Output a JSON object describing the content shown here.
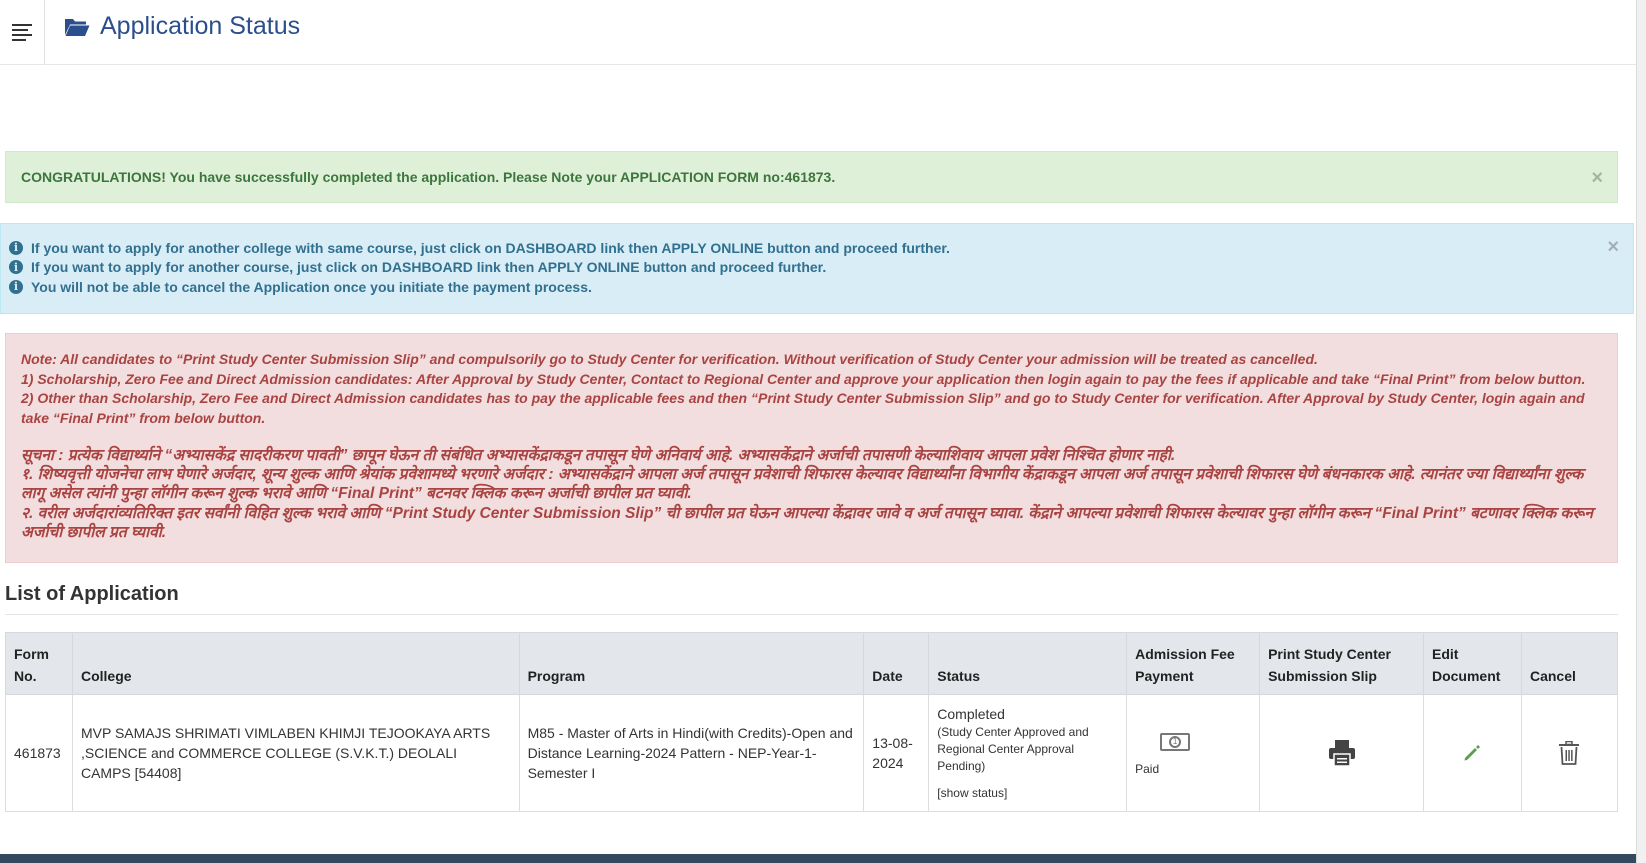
{
  "header": {
    "title": "Application Status",
    "menu_icon": "hamburger-icon",
    "title_icon": "folder-open-icon"
  },
  "alerts": {
    "success": {
      "text": "CONGRATULATIONS! You have successfully completed the application. Please Note your APPLICATION FORM no:461873.",
      "close": "×"
    },
    "info": {
      "lines": [
        "If you want to apply for another college with same course, just click on DASHBOARD link then APPLY ONLINE button and proceed further.",
        "If you want to apply for another course, just click on DASHBOARD link then APPLY ONLINE button and proceed further.",
        "You will not be able to cancel the Application once you initiate the payment process."
      ],
      "close": "×"
    },
    "danger": {
      "english": [
        "Note: All candidates to “Print Study Center Submission Slip” and compulsorily go to Study Center for verification. Without verification of Study Center your admission will be treated as cancelled.",
        "1) Scholarship, Zero Fee and Direct Admission candidates: After Approval by Study Center, Contact to Regional Center and approve your application then login again to pay the fees if applicable and take “Final Print” from below button.",
        "2) Other than Scholarship, Zero Fee and Direct Admission candidates has to pay the applicable fees and then “Print Study Center Submission Slip” and go to Study Center for verification. After Approval by Study Center, login again and take “Final Print” from below button."
      ],
      "marathi": [
        "सूचना : प्रत्येक विद्यार्थ्याने “अभ्यासकेंद्र सादरीकरण पावती” छापून घेऊन ती संबंधित अभ्यासकेंद्राकडून तपासून घेणे अनिवार्य आहे. अभ्यासकेंद्राने अर्जाची तपासणी केल्याशिवाय आपला प्रवेश निश्चित होणार नाही.",
        "१. शिष्यवृत्ती योजनेचा लाभ घेणारे अर्जदार, शून्य शुल्क आणि श्रेयांक प्रवेशामध्ये भरणारे अर्जदार : अभ्यासकेंद्राने आपला अर्ज तपासून प्रवेशाची शिफारस केल्यावर विद्यार्थ्यांना विभागीय केंद्राकडून आपला अर्ज तपासून प्रवेशाची शिफारस घेणे बंधनकारक आहे. त्यानंतर ज्या विद्यार्थ्यांना शुल्क लागू असेल त्यांनी पुन्हा लॉगीन करून शुल्क भरावे आणि “Final Print” बटनवर क्लिक करून अर्जाची छापील प्रत घ्यावी.",
        "२. वरील अर्जदारांव्यतिरिक्त इतर सर्वांनी विहित शुल्क भरावे आणि “Print Study Center Submission Slip” ची छापील प्रत घेऊन आपल्या केंद्रावर जावे व अर्ज तपासून घ्यावा. केंद्राने आपल्या प्रवेशाची शिफारस केल्यावर पुन्हा लॉगीन करून “Final Print” बटणावर क्लिक करून अर्जाची छापील प्रत घ्यावी."
      ]
    }
  },
  "list": {
    "heading": "List of Application",
    "columns": [
      "Form No.",
      "College",
      "Program",
      "Date",
      "Status",
      "Admission Fee Payment",
      "Print Study Center Submission Slip",
      "Edit Document",
      "Cancel"
    ],
    "rows": [
      {
        "form_no": "461873",
        "college": "MVP SAMAJS SHRIMATI VIMLABEN KHIMJI TEJOOKAYA ARTS ,SCIENCE and COMMERCE COLLEGE (S.V.K.T.) DEOLALI CAMPS [54408]",
        "program": "M85 - Master of Arts in Hindi(with Credits)-Open and Distance Learning-2024 Pattern - NEP-Year-1-Semester I",
        "date": "13-08-2024",
        "status": "Completed",
        "status_detail": "(Study Center Approved and Regional Center Approval Pending)",
        "show_status": "[show status]",
        "payment": "Paid",
        "payment_icon": "money-bill-icon",
        "print_icon": "printer-icon",
        "edit_icon": "pencil-icon",
        "cancel_icon": "trash-icon"
      }
    ]
  },
  "colors": {
    "title": "#2b4f8c",
    "success_bg": "#dff0d8",
    "info_bg": "#d9edf7",
    "danger_bg": "#f2dede",
    "danger_text": "#a94442",
    "table_header_bg": "#e3e7ec",
    "bottom_bar": "#34495e"
  }
}
